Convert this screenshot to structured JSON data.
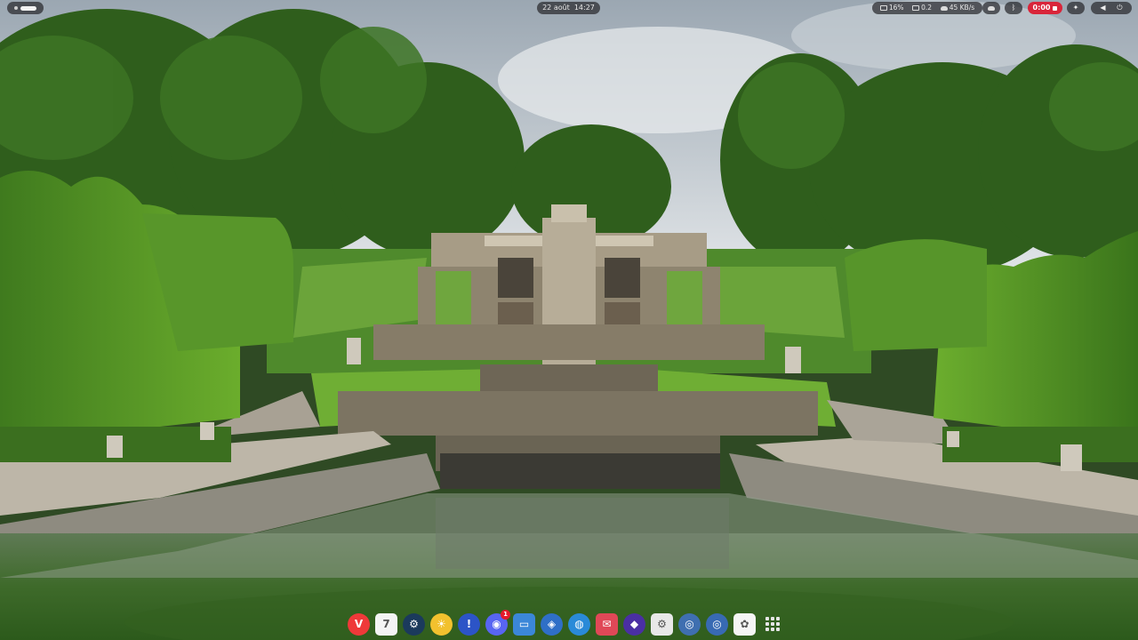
{
  "top_panel": {
    "clock": {
      "date": "22 août",
      "time": "14:27"
    },
    "stats": {
      "cpu": "16%",
      "memory": "0.2",
      "network": "45 KB/s"
    },
    "recording": {
      "time": "0:00"
    }
  },
  "dock": {
    "items": [
      {
        "name": "vivaldi",
        "glyph": "V",
        "color": "#ef3939"
      },
      {
        "name": "calendar",
        "glyph": "7",
        "color": "#f4f4f4"
      },
      {
        "name": "steam",
        "glyph": "⚙",
        "color": "#1b3a5c"
      },
      {
        "name": "weather",
        "glyph": "☀",
        "color": "#f2c12e"
      },
      {
        "name": "warning",
        "glyph": "!",
        "color": "#2c54c7"
      },
      {
        "name": "discord",
        "glyph": "◉",
        "color": "#5865f2",
        "badge": "1"
      },
      {
        "name": "files",
        "glyph": "▭",
        "color": "#3b87d8"
      },
      {
        "name": "virtualbox",
        "glyph": "◈",
        "color": "#2f6fc7"
      },
      {
        "name": "tweaks",
        "glyph": "◍",
        "color": "#2a8ad8"
      },
      {
        "name": "reader",
        "glyph": "✉",
        "color": "#e04857"
      },
      {
        "name": "graphics-app",
        "glyph": "◆",
        "color": "#4a2fa3"
      },
      {
        "name": "settings",
        "glyph": "⚙",
        "color": "#e8e8e8"
      },
      {
        "name": "disk-utility",
        "glyph": "◎",
        "color": "#3f6fb0"
      },
      {
        "name": "disk-usage",
        "glyph": "◎",
        "color": "#386ab3"
      },
      {
        "name": "app-center",
        "glyph": "✿",
        "color": "#f5f5f5"
      },
      {
        "name": "app-grid",
        "glyph": "",
        "color": "transparent"
      }
    ]
  }
}
